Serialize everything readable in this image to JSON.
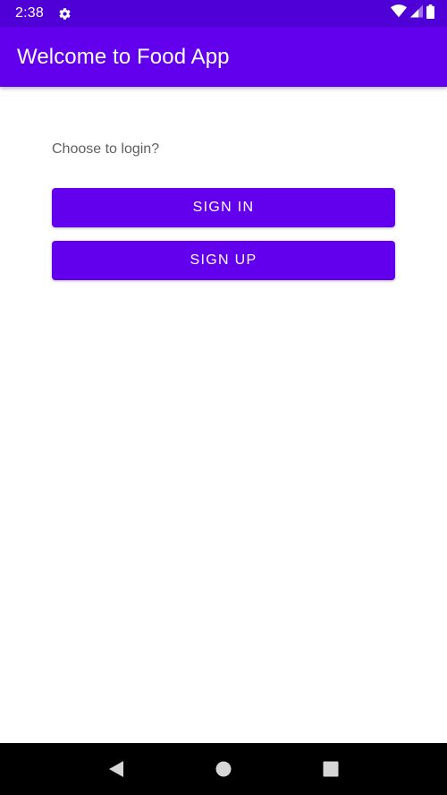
{
  "status_bar": {
    "time": "2:38",
    "background": "#4f00d6",
    "icons": [
      "gear-icon",
      "wifi-icon",
      "cell-signal-icon",
      "battery-icon"
    ]
  },
  "app_bar": {
    "title": "Welcome to Food App",
    "background": "#6200ee"
  },
  "content": {
    "prompt": "Choose to login?",
    "buttons": {
      "sign_in": "SIGN IN",
      "sign_up": "SIGN UP"
    },
    "button_color": "#6200ee"
  },
  "nav_bar": {
    "icons": [
      "back-icon",
      "home-icon",
      "recents-icon"
    ]
  }
}
